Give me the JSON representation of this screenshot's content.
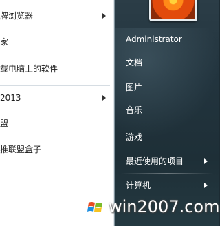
{
  "left_menu": {
    "items": [
      {
        "label": "牌浏览器",
        "has_arrow": true
      },
      {
        "label": "家",
        "has_arrow": false
      },
      {
        "label": "载电脑上的软件",
        "has_arrow": false
      },
      {
        "label": "2013",
        "has_arrow": true
      },
      {
        "label": "盟",
        "has_arrow": false
      },
      {
        "label": "推联盟盒子",
        "has_arrow": false
      }
    ]
  },
  "right_menu": {
    "user_name": "Administrator",
    "items": [
      {
        "label": "文档"
      },
      {
        "label": "图片"
      },
      {
        "label": "音乐"
      },
      {
        "label": "游戏"
      },
      {
        "label": "最近使用的项目",
        "has_arrow": true
      },
      {
        "label": "计算机",
        "has_arrow": true
      }
    ]
  },
  "watermark": {
    "text": "win2007.com"
  },
  "colors": {
    "left_bg": "#ffffff",
    "right_bg": "#22343e",
    "text_dark": "#1b1b1b",
    "text_light": "#ffffff"
  },
  "icons": {
    "user_picture": "orange-flower-picture",
    "watermark_logo": "windows-logo-icon"
  }
}
